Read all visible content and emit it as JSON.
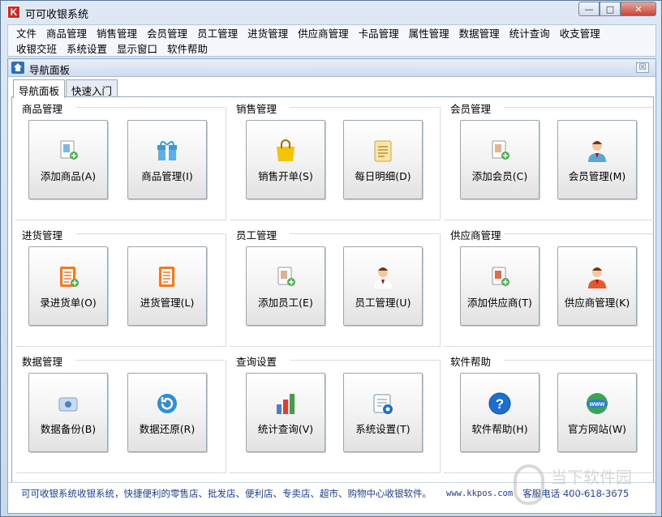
{
  "window": {
    "title": "可可收银系统"
  },
  "menu": {
    "row1": [
      "文件",
      "商品管理",
      "销售管理",
      "会员管理",
      "员工管理",
      "进货管理",
      "供应商管理",
      "卡品管理",
      "属性管理",
      "数据管理",
      "统计查询",
      "收支管理"
    ],
    "row2": [
      "收银交班",
      "系统设置",
      "显示窗口",
      "软件帮助"
    ]
  },
  "panel": {
    "title": "导航面板",
    "close": "☒"
  },
  "tabs": [
    {
      "label": "导航面板"
    },
    {
      "label": "快速入门"
    }
  ],
  "groups": [
    {
      "title": "商品管理",
      "tiles": [
        {
          "label": "添加商品(A)",
          "icon": "add-product-icon"
        },
        {
          "label": "商品管理(I)",
          "icon": "gift-box-icon"
        }
      ]
    },
    {
      "title": "销售管理",
      "tiles": [
        {
          "label": "销售开单(S)",
          "icon": "shopping-bag-icon"
        },
        {
          "label": "每日明细(D)",
          "icon": "daily-detail-icon"
        }
      ]
    },
    {
      "title": "会员管理",
      "tiles": [
        {
          "label": "添加会员(C)",
          "icon": "add-member-icon"
        },
        {
          "label": "会员管理(M)",
          "icon": "member-icon"
        }
      ]
    },
    {
      "title": "进货管理",
      "tiles": [
        {
          "label": "录进货单(O)",
          "icon": "add-purchase-icon"
        },
        {
          "label": "进货管理(L)",
          "icon": "purchase-list-icon"
        }
      ]
    },
    {
      "title": "员工管理",
      "tiles": [
        {
          "label": "添加员工(E)",
          "icon": "add-employee-icon"
        },
        {
          "label": "员工管理(U)",
          "icon": "employee-icon"
        }
      ]
    },
    {
      "title": "供应商管理",
      "tiles": [
        {
          "label": "添加供应商(T)",
          "icon": "add-supplier-icon"
        },
        {
          "label": "供应商管理(K)",
          "icon": "supplier-icon"
        }
      ]
    },
    {
      "title": "数据管理",
      "tiles": [
        {
          "label": "数据备份(B)",
          "icon": "backup-icon"
        },
        {
          "label": "数据还原(R)",
          "icon": "restore-icon"
        }
      ]
    },
    {
      "title": "查询设置",
      "tiles": [
        {
          "label": "统计查询(V)",
          "icon": "bar-chart-icon"
        },
        {
          "label": "系统设置(T)",
          "icon": "settings-icon"
        }
      ]
    },
    {
      "title": "软件帮助",
      "tiles": [
        {
          "label": "软件帮助(H)",
          "icon": "help-icon"
        },
        {
          "label": "官方网站(W)",
          "icon": "www-globe-icon"
        }
      ]
    }
  ],
  "status": {
    "text": "可可收银系统收银系统，快捷便利的零售店、批发店、便利店、专卖店、超市、购物中心收银软件。",
    "site": "www.kkpos.com",
    "phone": "客服电话 400-618-3675"
  },
  "watermark": {
    "text": "当下软件园",
    "sub": "www.downxia.com"
  },
  "colors": {
    "status_text": "#1d3f9a",
    "close_button": "#c7443a"
  }
}
